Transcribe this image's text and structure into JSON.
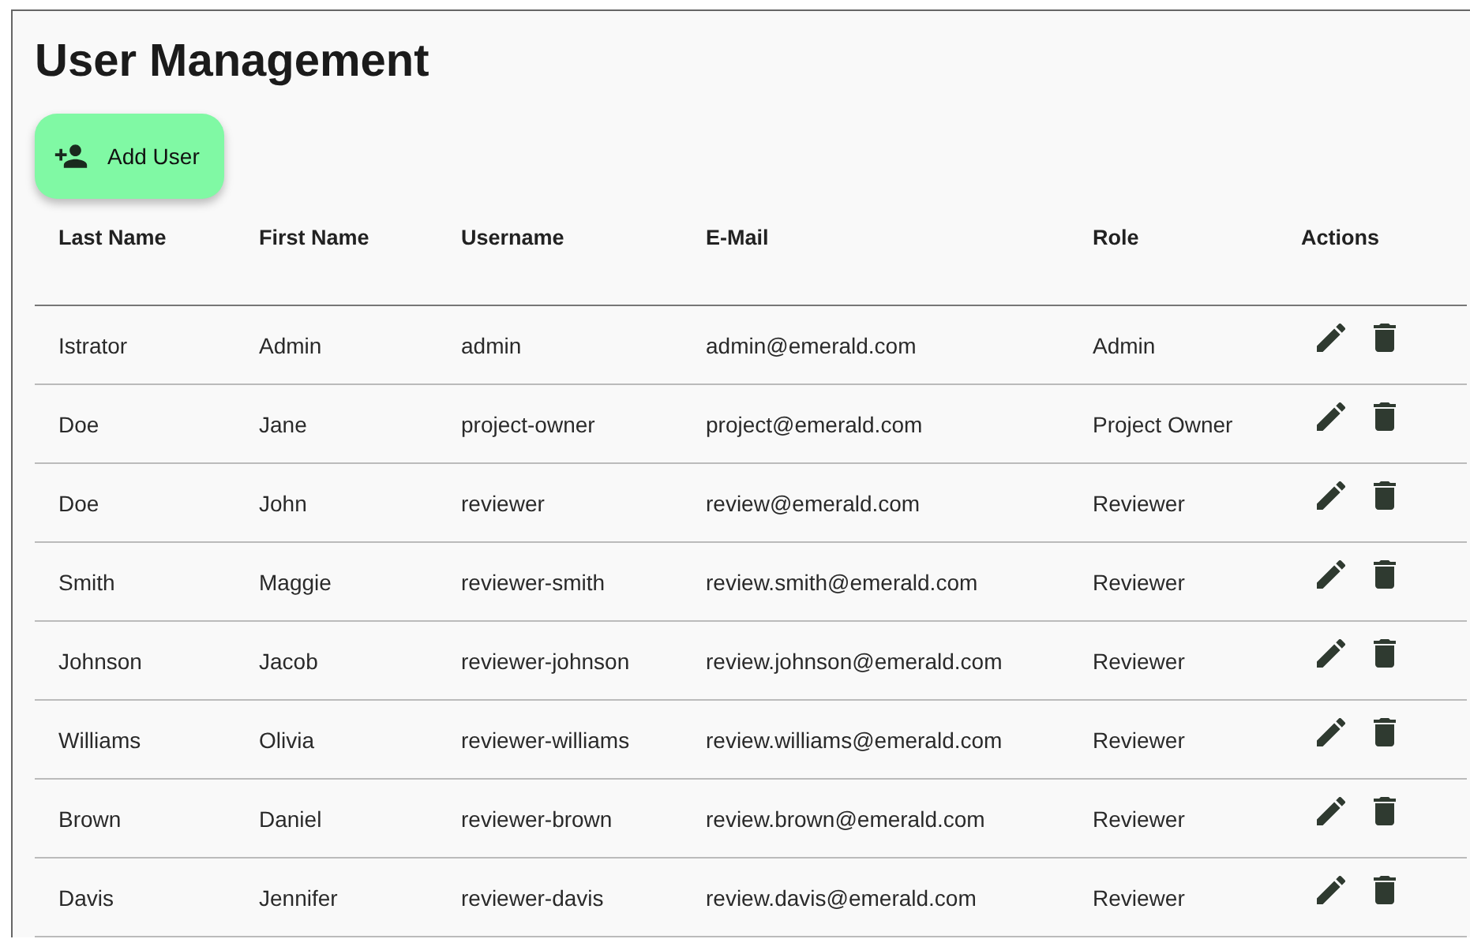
{
  "title": "User Management",
  "add_button": {
    "label": "Add User"
  },
  "table": {
    "columns": [
      "Last Name",
      "First Name",
      "Username",
      "E-Mail",
      "Role",
      "Actions"
    ],
    "rows": [
      {
        "cells": [
          "Istrator",
          "Admin",
          "admin",
          "admin@emerald.com",
          "Admin"
        ]
      },
      {
        "cells": [
          "Doe",
          "Jane",
          "project-owner",
          "project@emerald.com",
          "Project Owner"
        ]
      },
      {
        "cells": [
          "Doe",
          "John",
          "reviewer",
          "review@emerald.com",
          "Reviewer"
        ]
      },
      {
        "cells": [
          "Smith",
          "Maggie",
          "reviewer-smith",
          "review.smith@emerald.com",
          "Reviewer"
        ]
      },
      {
        "cells": [
          "Johnson",
          "Jacob",
          "reviewer-johnson",
          "review.johnson@emerald.com",
          "Reviewer"
        ]
      },
      {
        "cells": [
          "Williams",
          "Olivia",
          "reviewer-williams",
          "review.williams@emerald.com",
          "Reviewer"
        ]
      },
      {
        "cells": [
          "Brown",
          "Daniel",
          "reviewer-brown",
          "review.brown@emerald.com",
          "Reviewer"
        ]
      },
      {
        "cells": [
          "Davis",
          "Jennifer",
          "reviewer-davis",
          "review.davis@emerald.com",
          "Reviewer"
        ]
      }
    ]
  }
}
